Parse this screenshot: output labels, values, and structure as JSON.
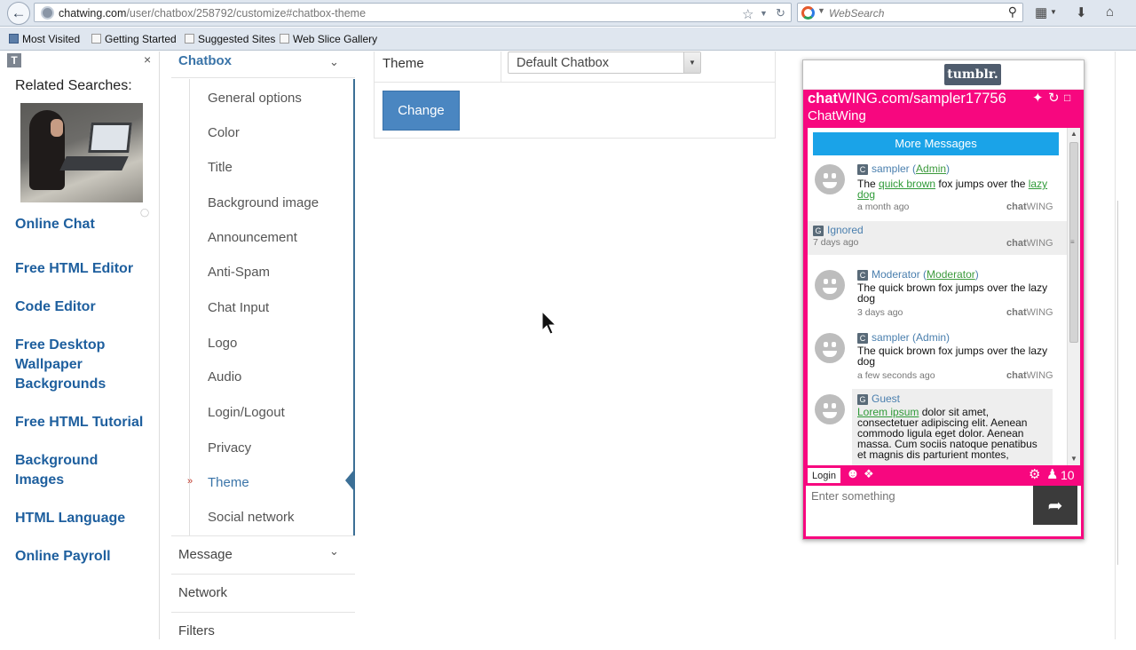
{
  "browser": {
    "url_host": "chatwing.com",
    "url_path": "/user/chatbox/258792/customize#chatbox-theme",
    "search_placeholder": "WebSearch",
    "bookmarks": [
      "Most Visited",
      "Getting Started",
      "Suggested Sites",
      "Web Slice Gallery"
    ]
  },
  "related": {
    "logo_letter": "T",
    "close": "×",
    "title": "Related Searches:",
    "links": [
      "Online Chat",
      "Free HTML Editor",
      "Code Editor",
      "Free Desktop Wallpaper Backgrounds",
      "Free HTML Tutorial",
      "Background Images",
      "HTML Language",
      "Online Payroll"
    ]
  },
  "sidebar": {
    "chatbox_label": "Chatbox",
    "submenu": [
      "General options",
      "Color",
      "Title",
      "Background image",
      "Announcement",
      "Anti-Spam",
      "Chat Input",
      "Logo",
      "Audio",
      "Login/Logout",
      "Privacy",
      "Theme",
      "Social network"
    ],
    "active_item": "Theme",
    "sections": [
      "Message",
      "Network",
      "Filters"
    ]
  },
  "theme_form": {
    "label": "Theme",
    "selected": "Default Chatbox",
    "change_button": "Change"
  },
  "chat": {
    "tumblr": "tumblr.",
    "title_bold": "chat",
    "title_rest": "WING.com/sampler17756",
    "subtitle": "ChatWing",
    "more_messages": "More Messages",
    "brand_bold": "chat",
    "brand_rest": "WING",
    "login": "Login",
    "user_count": "10",
    "input_placeholder": "Enter something",
    "colors": {
      "accent": "#f7077f",
      "more_bg": "#1aa3e8",
      "link": "#2f9a38"
    },
    "messages": [
      {
        "badge": "C",
        "name": "sampler",
        "role": "Admin",
        "link1": "quick brown",
        "pre": "The ",
        "mid": " fox jumps over the ",
        "link2": "lazy dog",
        "time": "a month ago"
      },
      {
        "badge": "G",
        "name": "Ignored",
        "time": "7 days ago"
      },
      {
        "badge": "C",
        "name": "Moderator",
        "role": "Moderator",
        "text": "The quick brown fox jumps over the lazy dog",
        "time": "3 days ago"
      },
      {
        "badge": "C",
        "name": "sampler",
        "role": "Admin",
        "text": "The quick brown fox jumps over the lazy dog",
        "time": "a few seconds ago"
      },
      {
        "badge": "G",
        "name": "Guest",
        "link1": "Lorem ipsum",
        "text_rest": " dolor sit amet, consectetuer adipiscing elit. Aenean commodo ligula eget dolor. Aenean massa. Cum sociis natoque penatibus et magnis dis parturient montes,"
      }
    ]
  }
}
